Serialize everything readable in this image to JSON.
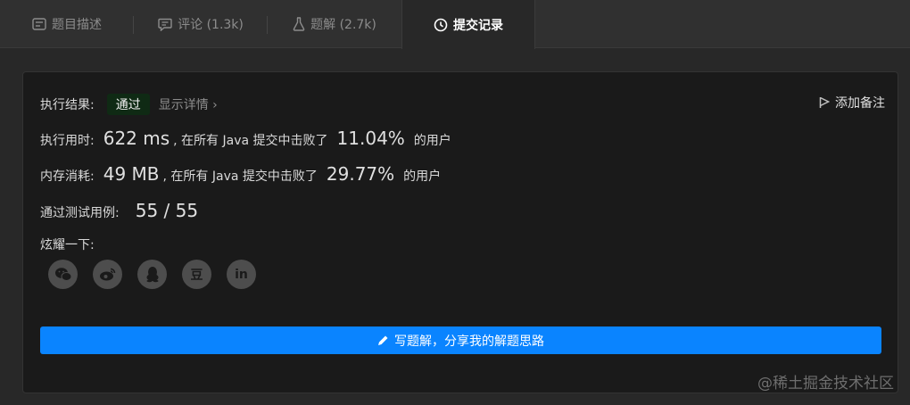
{
  "tabs": [
    {
      "label": "题目描述",
      "icon": "description-icon"
    },
    {
      "label": "评论 (1.3k)",
      "icon": "comment-icon"
    },
    {
      "label": "题解 (2.7k)",
      "icon": "flask-icon"
    },
    {
      "label": "提交记录",
      "icon": "clock-icon"
    }
  ],
  "result": {
    "label": "执行结果:",
    "status": "通过",
    "details": "显示详情 ›",
    "add_note": "添加备注"
  },
  "runtime": {
    "label": "执行用时:",
    "value": "622 ms",
    "mid": ", 在所有 Java 提交中击败了",
    "percent": "11.04%",
    "suffix": "的用户"
  },
  "memory": {
    "label": "内存消耗:",
    "value": "49 MB",
    "mid": ", 在所有 Java 提交中击败了",
    "percent": "29.77%",
    "suffix": "的用户"
  },
  "tests": {
    "label": "通过测试用例:",
    "value": "55 / 55"
  },
  "share": {
    "label": "炫耀一下:",
    "icons": [
      "wechat-icon",
      "weibo-icon",
      "qq-icon",
      "douban-icon",
      "linkedin-icon"
    ],
    "douban_glyph": "豆",
    "linkedin_glyph": "in"
  },
  "write_button": "写题解，分享我的解题思路",
  "watermark": "@稀土掘金技术社区",
  "colors": {
    "accent": "#0a84ff",
    "success_bg": "#0f2a14",
    "card_bg": "#1a1a1a",
    "page_bg": "#282828"
  }
}
